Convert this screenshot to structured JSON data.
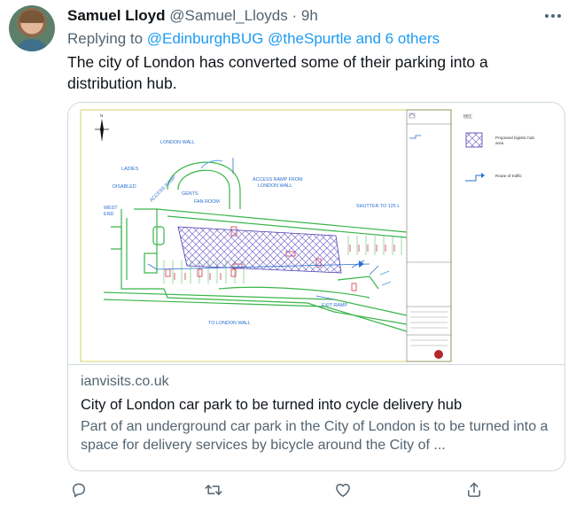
{
  "tweet": {
    "author_name": "Samuel Lloyd",
    "author_handle": "@Samuel_Lloyds",
    "separator": "·",
    "time": "9h",
    "reply_prefix": "Replying to",
    "reply_mentions": "@EdinburghBUG @theSpurtle and 6 others",
    "text": "The city of London has converted some of their parking into a distribution hub."
  },
  "card": {
    "domain": "ianvisits.co.uk",
    "title": "City of London car park to be turned into cycle delivery hub",
    "description": "Part of an underground car park in the City of London is to be turned into a space for delivery services by bicycle around the City of ...",
    "map": {
      "london_wall": "LONDON WALL",
      "ladies": "LADIES",
      "disabled": "DISABLED",
      "access_ramp": "ACCESS RAMP",
      "gents": "GENTS",
      "access_ramp_from_1": "ACCESS RAMP FROM",
      "access_ramp_from_2": "LONDON WALL",
      "fan_room": "FAN ROOM",
      "west": "WEST",
      "end": "END",
      "shutter": "SHUTTER TO 125 L",
      "exit_ramp": "EXIT RAMP",
      "to_london_wall": "TO LONDON WALL",
      "north": "N",
      "key_label": "KEY",
      "key_hub_1": "Proposed logistic hub",
      "key_hub_2": "area",
      "key_traffic": "Route of traffic"
    }
  },
  "actions": [
    {
      "name": "reply",
      "icon": "reply-icon"
    },
    {
      "name": "retweet",
      "icon": "retweet-icon"
    },
    {
      "name": "like",
      "icon": "like-icon"
    },
    {
      "name": "share",
      "icon": "share-icon"
    }
  ],
  "colors": {
    "link": "#1d9bf0",
    "secondary_text": "#536471",
    "map_green": "#39b54a",
    "map_blue": "#2b6fd1",
    "hatch": "#7b6fd0"
  }
}
